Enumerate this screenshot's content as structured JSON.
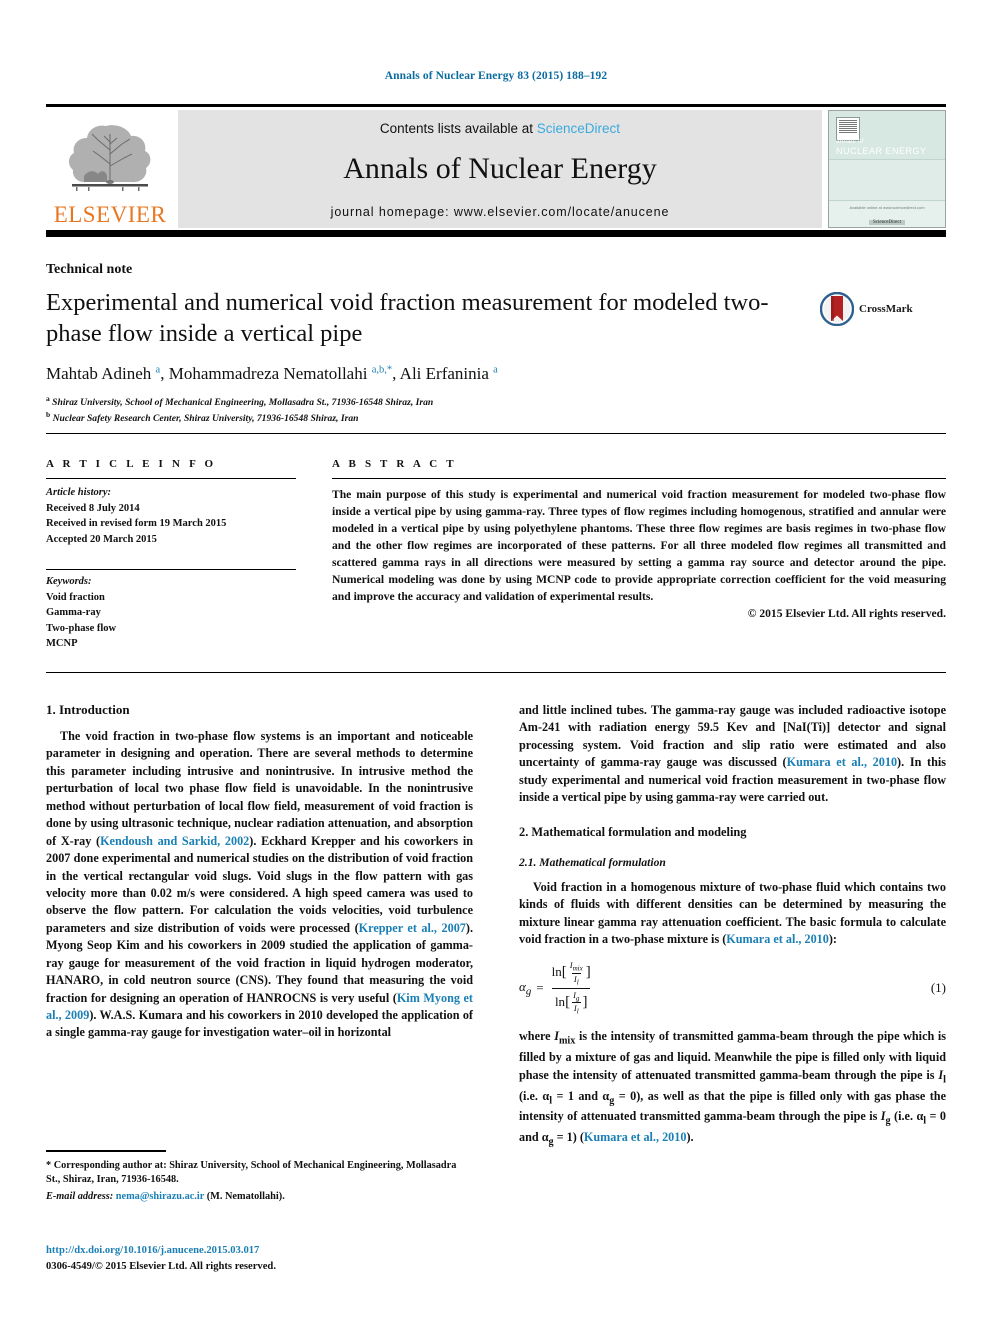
{
  "running_head": "Annals of Nuclear Energy 83 (2015) 188–192",
  "masthead": {
    "contents_prefix": "Contents lists available at",
    "sciencedirect": "ScienceDirect",
    "journal_title": "Annals of Nuclear Energy",
    "homepage": "journal homepage: www.elsevier.com/locate/anucene",
    "publisher_wordmark": "ELSEVIER",
    "cover": {
      "line1": "annals of",
      "line2": "NUCLEAR ENERGY",
      "foot1": "Available online at www.sciencedirect.com",
      "foot2": "ScienceDirect"
    }
  },
  "article": {
    "type_label": "Technical note",
    "title": "Experimental and numerical void fraction measurement for modeled two-phase flow inside a vertical pipe",
    "crossmark_label": "CrossMark",
    "authors_html": "Mahtab Adineh <sup>a</sup>, Mohammadreza Nematollahi <sup>a,b,</sup><sup>*</sup>, Ali Erfaninia <sup>a</sup>",
    "affiliation_a": "Shiraz University, School of Mechanical Engineering, Mollasadra St., 71936-16548 Shiraz, Iran",
    "affiliation_b": "Nuclear Safety Research Center, Shiraz University, 71936-16548 Shiraz, Iran"
  },
  "info": {
    "heading": "A R T I C L E  I N F O",
    "history_label": "Article history:",
    "history": [
      "Received 8 July 2014",
      "Received in revised form 19 March 2015",
      "Accepted 20 March 2015"
    ],
    "keywords_label": "Keywords:",
    "keywords": [
      "Void fraction",
      "Gamma-ray",
      "Two-phase flow",
      "MCNP"
    ]
  },
  "abstract": {
    "heading": "A B S T R A C T",
    "text": "The main purpose of this study is experimental and numerical void fraction measurement for modeled two-phase flow inside a vertical pipe by using gamma-ray. Three types of flow regimes including homogenous, stratified and annular were modeled in a vertical pipe by using polyethylene phantoms. These three flow regimes are basis regimes in two-phase flow and the other flow regimes are incorporated of these patterns. For all three modeled flow regimes all transmitted and scattered gamma rays in all directions were measured by setting a gamma ray source and detector around the pipe. Numerical modeling was done by using MCNP code to provide appropriate correction coefficient for the void measuring and improve the accuracy and validation of experimental results.",
    "copyright": "© 2015 Elsevier Ltd. All rights reserved."
  },
  "sections": {
    "intro_heading": "1. Introduction",
    "intro_p1_a": "The void fraction in two-phase flow systems is an important and noticeable parameter in designing and operation. There are several methods to determine this parameter including intrusive and nonintrusive. In intrusive method the perturbation of local two phase flow field is unavoidable. In the nonintrusive method without perturbation of local flow field, measurement of void fraction is done by using ultrasonic technique, nuclear radiation attenuation, and absorption of X-ray (",
    "cite1": "Kendoush and Sarkid, 2002",
    "intro_p1_b": "). Eckhard Krepper and his coworkers in 2007 done experimental and numerical studies on the distribution of void fraction in the vertical rectangular void slugs. Void slugs in the flow pattern with gas velocity more than 0.02 m/s were considered. A high speed camera was used to observe the flow pattern. For calculation the voids velocities, void turbulence parameters and size distribution of voids were processed (",
    "cite2": "Krepper et al., 2007",
    "intro_p1_c": "). Myong Seop Kim and his coworkers in 2009 studied the application of gamma-ray gauge for measurement of the void fraction in liquid hydrogen moderator, HANARO, in cold neutron source (CNS). They found that measuring the void fraction for designing an operation of HANROCNS is very useful (",
    "cite3": "Kim Myong et al., 2009",
    "intro_p1_d": "). W.A.S. Kumara and his coworkers in 2010 developed the application of a single gamma-ray gauge for investigation water–oil in horizontal and little inclined tubes. The gamma-ray gauge was included radioactive isotope Am-241 with radiation energy 59.5 Kev and [NaI(Ti)] detector and signal processing system. Void fraction and slip ratio were estimated and also uncertainty of gamma-ray gauge was discussed (",
    "cite4": "Kumara et al., 2010",
    "intro_p1_e": "). In this study experimental and numerical void fraction measurement in two-phase flow inside a vertical pipe by using gamma-ray were carried out.",
    "math_heading": "2. Mathematical formulation and modeling",
    "math_sub_heading": "2.1. Mathematical formulation",
    "math_p1_a": "Void fraction in a homogenous mixture of two-phase fluid which contains two kinds of fluids with different densities can be determined by measuring the mixture linear gamma ray attenuation coefficient. The basic formula to calculate void fraction in a two-phase mixture is (",
    "cite5": "Kumara et al., 2010",
    "math_p1_b": "):",
    "equation": {
      "lhs": "α",
      "lhs_sub": "g",
      "eq": "=",
      "num_fn": "ln",
      "num_top": "I",
      "num_top_sub": "mix",
      "num_bot": "I",
      "num_bot_sub": "l",
      "den_fn": "ln",
      "den_top": "I",
      "den_top_sub": "g",
      "den_bot": "I",
      "den_bot_sub": "l",
      "number": "(1)"
    },
    "math_p2_a": "where ",
    "math_p2_i1": "I",
    "math_p2_i1s": "mix",
    "math_p2_b": " is the intensity of transmitted gamma-beam through the pipe which is filled by a mixture of gas and liquid. Meanwhile the pipe is filled only with liquid phase the intensity of attenuated transmitted gamma-beam through the pipe is ",
    "math_p2_i2": "I",
    "math_p2_i2s": "l",
    "math_p2_c": " (i.e. α",
    "math_p2_d": "l",
    "math_p2_e": " = 1 and α",
    "math_p2_f": "g",
    "math_p2_g": " = 0), as well as that the pipe is filled only with gas phase the intensity of attenuated transmitted gamma-beam through the pipe is ",
    "math_p2_i3": "I",
    "math_p2_i3s": "g",
    "math_p2_h": " (i.e. α",
    "math_p2_i": "l",
    "math_p2_j": " = 0 and α",
    "math_p2_k": "g",
    "math_p2_l": " = 1) (",
    "cite6": "Kumara et al., 2010",
    "math_p2_m": ")."
  },
  "footer": {
    "corresponding": "* Corresponding author at: Shiraz University, School of Mechanical Engineering, Mollasadra St., Shiraz, Iran, 71936-16548.",
    "email_label": "E-mail address:",
    "email": "nema@shirazu.ac.ir",
    "email_suffix": "(M. Nematollahi).",
    "doi": "http://dx.doi.org/10.1016/j.anucene.2015.03.017",
    "issn_line": "0306-4549/© 2015 Elsevier Ltd. All rights reserved."
  },
  "colors": {
    "link": "#1a7fb5",
    "sciencedirect": "#3ba9dd",
    "elsevier_orange": "#e87722",
    "masthead_gray": "#e3e3e3",
    "cover_mint": "#ddeae4"
  }
}
